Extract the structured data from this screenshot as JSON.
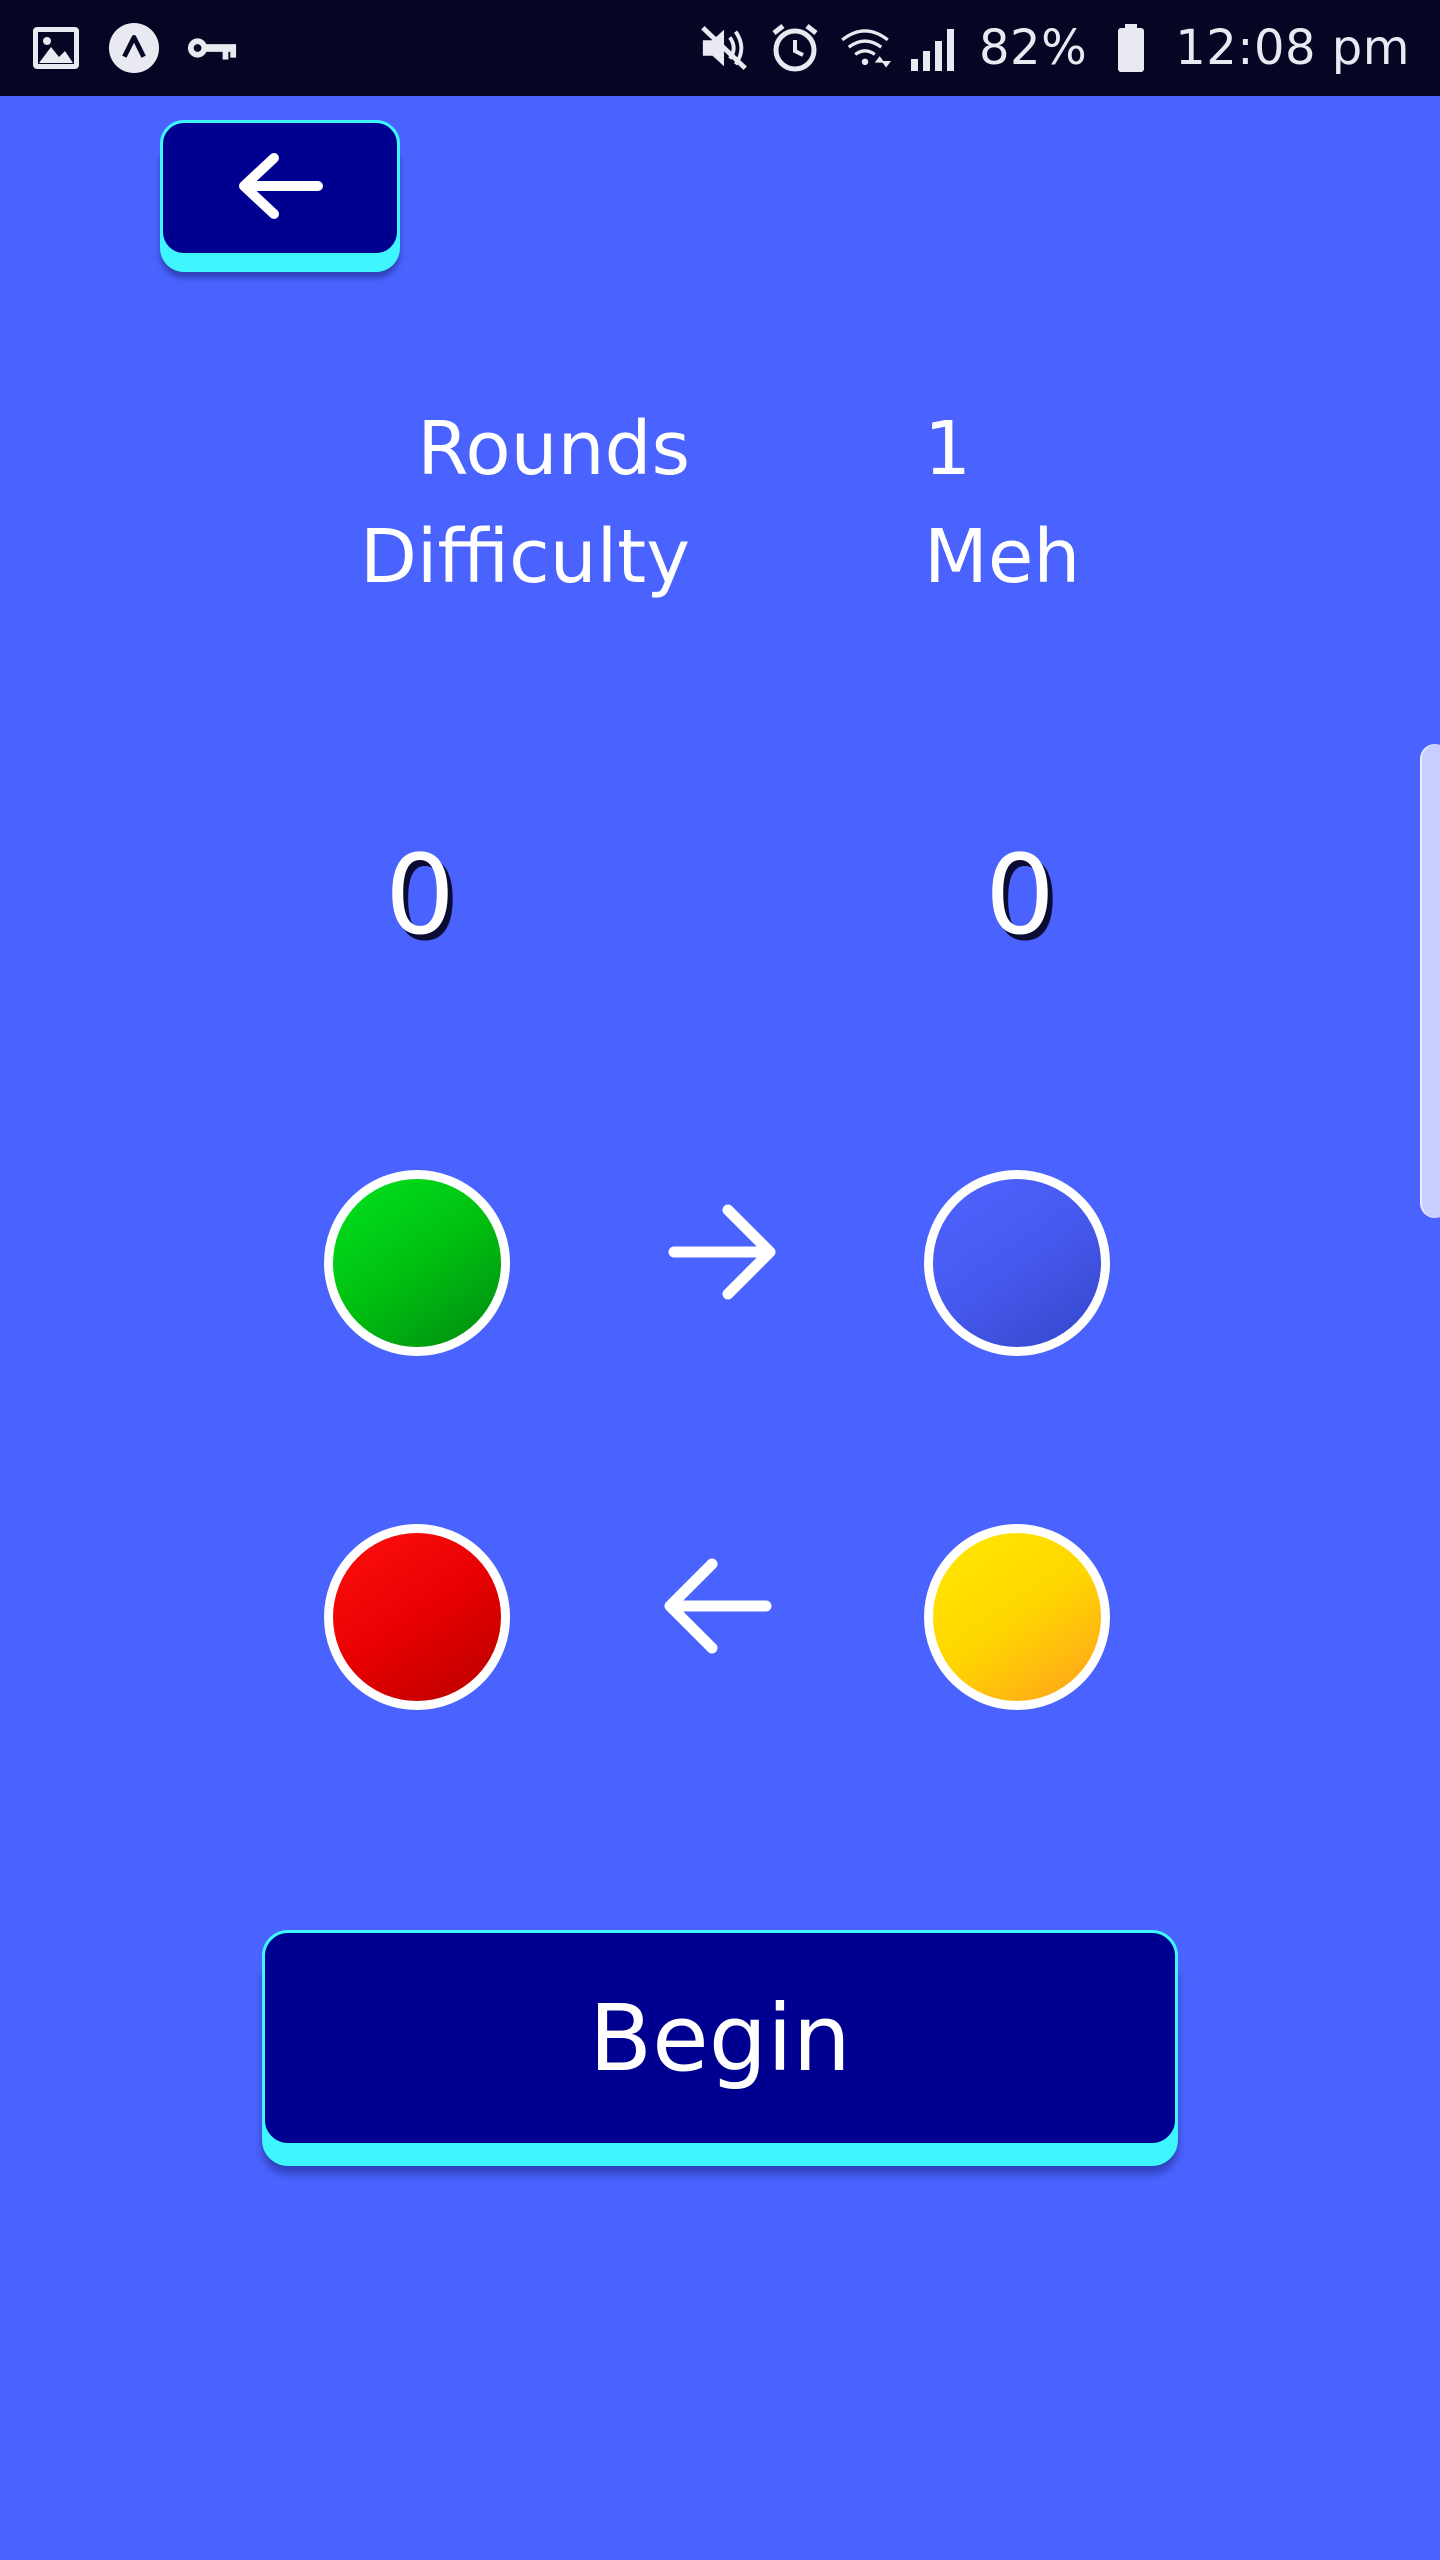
{
  "status_bar": {
    "battery_percent": "82%",
    "time": "12:08 pm",
    "left_icons": [
      "gallery-icon",
      "app-notification-icon",
      "vpn-key-icon"
    ],
    "right_icons": [
      "mute-icon",
      "alarm-icon",
      "wifi-icon",
      "signal-icon",
      "battery-icon"
    ]
  },
  "header": {
    "back_icon": "arrow-left-icon"
  },
  "settings": {
    "rounds_label": "Rounds",
    "rounds_value": "1",
    "difficulty_label": "Difficulty",
    "difficulty_value": "Meh"
  },
  "scores": {
    "left": "0",
    "right": "0"
  },
  "circles": {
    "top_left": {
      "color": "green",
      "hex": "#00c010"
    },
    "top_right": {
      "color": "blue",
      "hex": "#4659ee"
    },
    "bottom_left": {
      "color": "red",
      "hex": "#e80000"
    },
    "bottom_right": {
      "color": "yellow",
      "hex": "#ffd600"
    },
    "top_arrow_icon": "arrow-right-icon",
    "bottom_arrow_icon": "arrow-left-icon"
  },
  "actions": {
    "begin_label": "Begin"
  },
  "colors": {
    "background": "#4a63ff",
    "button_fill": "#000090",
    "button_accent": "#3ff6ff",
    "status_bar": "#050524"
  }
}
